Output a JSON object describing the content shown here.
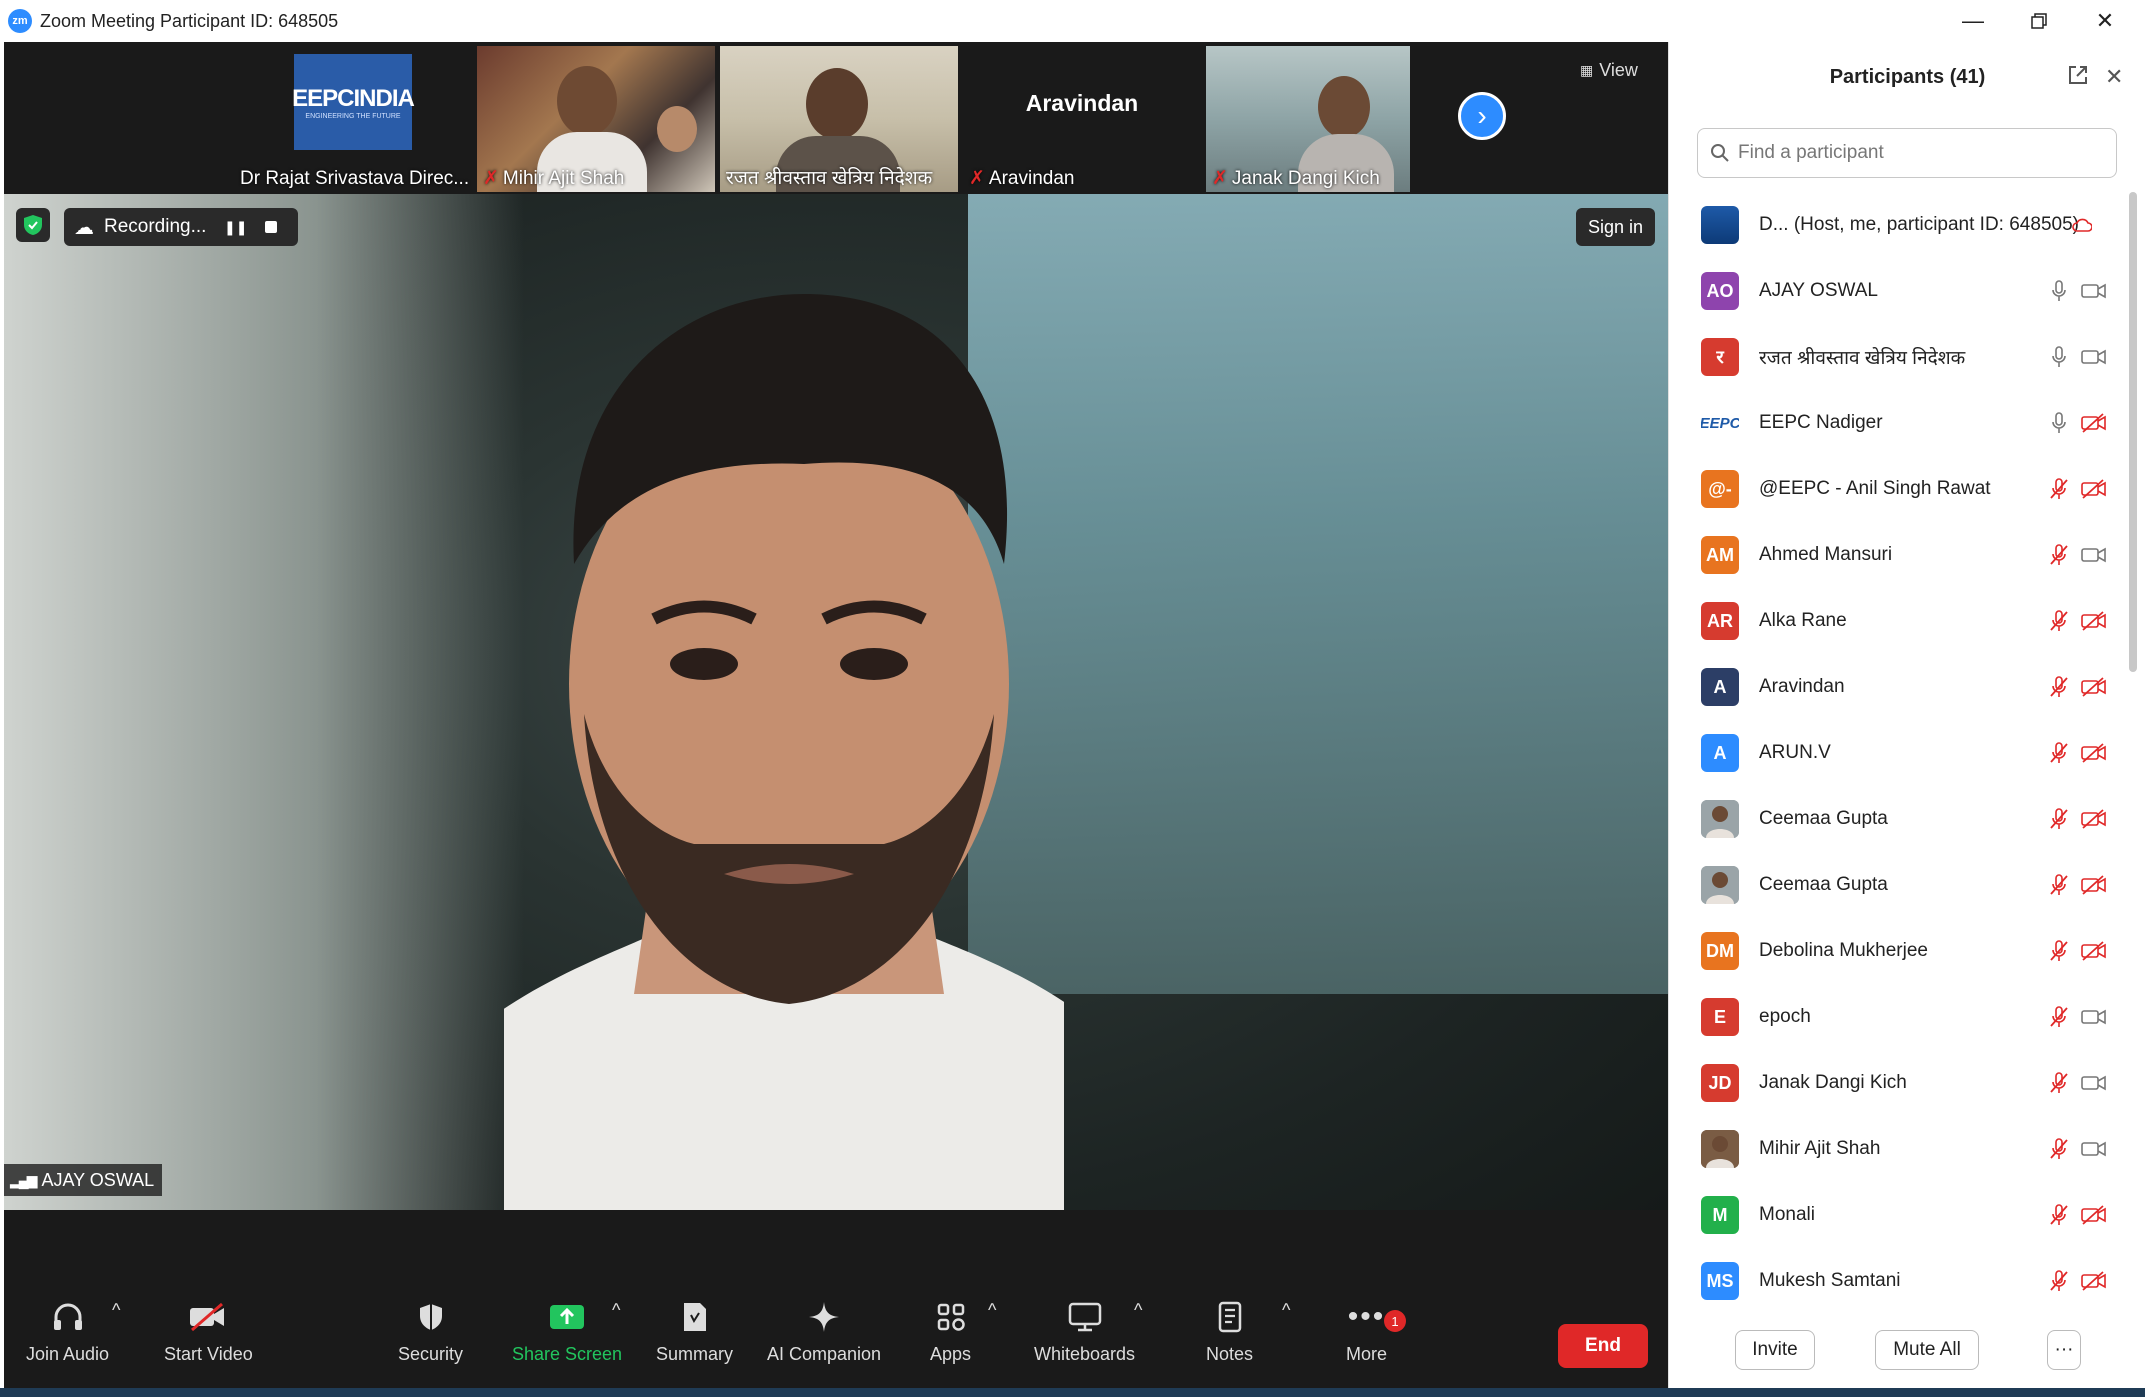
{
  "window": {
    "title": "Zoom Meeting Participant ID: 648505",
    "logo_text": "zm"
  },
  "meeting": {
    "thumbnails": [
      {
        "name": "Dr Rajat Srivastava Direc...",
        "logo_text": "EEPCINDIA",
        "logo_sub": "ENGINEERING THE FUTURE",
        "muted": false
      },
      {
        "name": "Mihir Ajit Shah",
        "muted": true
      },
      {
        "name": "रजत श्रीवस्ताव खेत्रिय निदेशक",
        "muted": false
      },
      {
        "name": "Aravindan",
        "big_name": "Aravindan",
        "muted": true
      },
      {
        "name": "Janak Dangi Kich",
        "muted": true
      }
    ],
    "view_label": "View",
    "recording_label": "Recording...",
    "sign_in_label": "Sign in",
    "active_speaker": "AJAY OSWAL"
  },
  "toolbar": {
    "join_audio": "Join Audio",
    "start_video": "Start Video",
    "security": "Security",
    "share_screen": "Share Screen",
    "summary": "Summary",
    "ai_companion": "AI Companion",
    "apps": "Apps",
    "whiteboards": "Whiteboards",
    "notes": "Notes",
    "more": "More",
    "more_badge": "1",
    "end": "End",
    "colors": {
      "share": "#22c55e",
      "end": "#e02828",
      "accent": "#2d8cff"
    }
  },
  "participants": {
    "title": "Participants (41)",
    "search_placeholder": "Find a participant",
    "invite_label": "Invite",
    "mute_all_label": "Mute All",
    "more_label": "···",
    "list": [
      {
        "name": "D... (Host, me, participant ID: 648505)",
        "initials": "",
        "color": "#1e5aa8",
        "avatar": "logo",
        "mic": "none",
        "cam": "none"
      },
      {
        "name": "AJAY OSWAL",
        "initials": "AO",
        "color": "#8e44ad",
        "avatar": "initials",
        "mic": "on",
        "cam": "on"
      },
      {
        "name": "रजत श्रीवस्ताव खेत्रिय निदेशक",
        "initials": "र",
        "color": "#d63b2f",
        "avatar": "initials",
        "mic": "on",
        "cam": "on"
      },
      {
        "name": "EEPC Nadiger",
        "initials": "EEPC",
        "color": "#ffffff",
        "avatar": "eepc",
        "mic": "on",
        "cam": "off"
      },
      {
        "name": "@EEPC - Anil Singh Rawat",
        "initials": "@-",
        "color": "#e8741f",
        "avatar": "initials",
        "mic": "off",
        "cam": "off"
      },
      {
        "name": "Ahmed Mansuri",
        "initials": "AM",
        "color": "#e8741f",
        "avatar": "initials",
        "mic": "off",
        "cam": "on"
      },
      {
        "name": "Alka Rane",
        "initials": "AR",
        "color": "#d63b2f",
        "avatar": "initials",
        "mic": "off",
        "cam": "off"
      },
      {
        "name": "Aravindan",
        "initials": "A",
        "color": "#2c3e66",
        "avatar": "initials",
        "mic": "off",
        "cam": "off"
      },
      {
        "name": "ARUN.V",
        "initials": "A",
        "color": "#2d8cff",
        "avatar": "initials",
        "mic": "off",
        "cam": "off"
      },
      {
        "name": "Ceemaa Gupta",
        "initials": "",
        "color": "#9aa4a8",
        "avatar": "photo",
        "mic": "off",
        "cam": "off"
      },
      {
        "name": "Ceemaa Gupta",
        "initials": "",
        "color": "#9aa4a8",
        "avatar": "photo",
        "mic": "off",
        "cam": "off"
      },
      {
        "name": "Debolina Mukherjee",
        "initials": "DM",
        "color": "#e8741f",
        "avatar": "initials",
        "mic": "off",
        "cam": "off"
      },
      {
        "name": "epoch",
        "initials": "E",
        "color": "#d63b2f",
        "avatar": "initials",
        "mic": "off",
        "cam": "on"
      },
      {
        "name": "Janak Dangi Kich",
        "initials": "JD",
        "color": "#d63b2f",
        "avatar": "initials",
        "mic": "off",
        "cam": "on"
      },
      {
        "name": "Mihir Ajit Shah",
        "initials": "",
        "color": "#7a5c44",
        "avatar": "photo",
        "mic": "off",
        "cam": "on"
      },
      {
        "name": "Monali",
        "initials": "M",
        "color": "#22b04b",
        "avatar": "initials",
        "mic": "off",
        "cam": "off"
      },
      {
        "name": "Mukesh Samtani",
        "initials": "MS",
        "color": "#2d8cff",
        "avatar": "initials",
        "mic": "off",
        "cam": "off"
      }
    ]
  }
}
